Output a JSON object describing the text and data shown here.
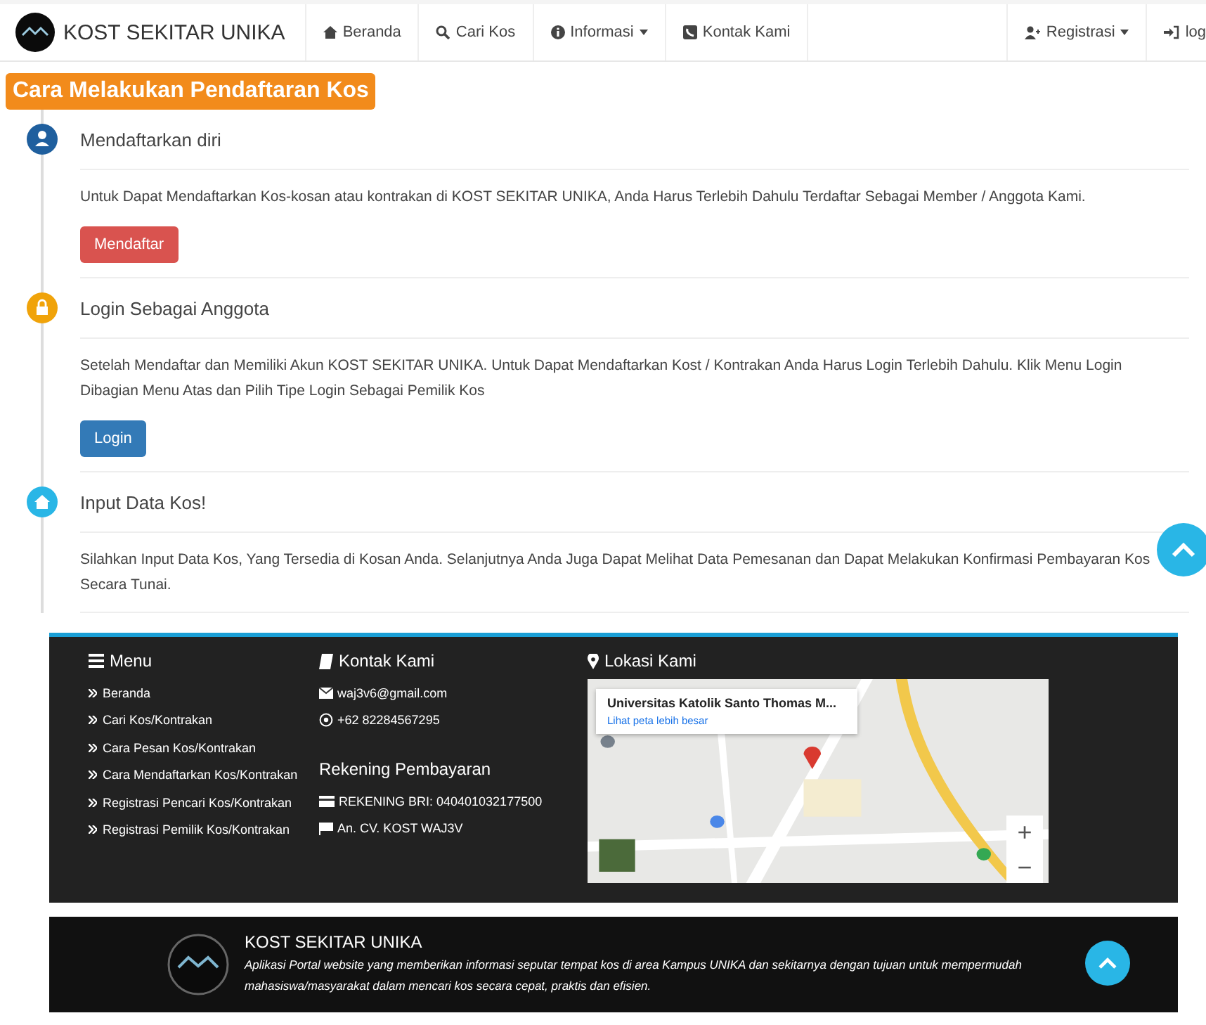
{
  "navbar": {
    "brand": "KOST SEKITAR UNIKA",
    "items": [
      {
        "label": "Beranda",
        "dropdown": false
      },
      {
        "label": "Cari Kos",
        "dropdown": false
      },
      {
        "label": "Informasi",
        "dropdown": true
      },
      {
        "label": "Kontak Kami",
        "dropdown": false
      }
    ],
    "right_items": [
      {
        "label": "Registrasi",
        "dropdown": true
      },
      {
        "label": "log",
        "dropdown": false
      }
    ]
  },
  "page_title": "Cara Melakukan Pendaftaran Kos",
  "steps": [
    {
      "title": "Mendaftarkan diri",
      "color": "#1f5f9e",
      "text": "Untuk Dapat Mendaftarkan Kos-kosan atau kontrakan di KOST SEKITAR UNIKA, Anda Harus Terlebih Dahulu Terdaftar Sebagai Member / Anggota Kami.",
      "button": {
        "label": "Mendaftar",
        "kind": "danger"
      }
    },
    {
      "title": "Login Sebagai Anggota",
      "color": "#f0a30a",
      "text": "Setelah Mendaftar dan Memiliki Akun KOST SEKITAR UNIKA. Untuk Dapat Mendaftarkan Kost / Kontrakan Anda Harus Login Terlebih Dahulu. Klik Menu Login Dibagian Menu Atas dan Pilih Tipe Login Sebagai Pemilik Kos",
      "button": {
        "label": "Login",
        "kind": "primary"
      }
    },
    {
      "title": "Input Data Kos!",
      "color": "#29b6e6",
      "text": "Silahkan Input Data Kos, Yang Tersedia di Kosan Anda. Selanjutnya Anda Juga Dapat Melihat Data Pemesanan dan Dapat Melakukan Konfirmasi Pembayaran Kos Secara Tunai."
    }
  ],
  "footer": {
    "menu": {
      "heading": "Menu",
      "links": [
        "Beranda",
        "Cari Kos/Kontrakan",
        "Cara Pesan Kos/Kontrakan",
        "Cara Mendaftarkan Kos/Kontrakan",
        "Registrasi Pencari Kos/Kontrakan",
        "Registrasi Pemilik Kos/Kontrakan"
      ]
    },
    "contact": {
      "heading": "Kontak Kami",
      "items": [
        "waj3v6@gmail.com",
        "+62 82284567295"
      ]
    },
    "payment": {
      "heading": "Rekening Pembayaran",
      "items": [
        "REKENING BRI: 040401032177500",
        "An. CV. KOST WAJ3V"
      ]
    },
    "location": {
      "heading": "Lokasi Kami",
      "map": {
        "place": "Universitas Katolik Santo Thomas M...",
        "link": "Lihat peta lebih besar",
        "zoom_in": "+",
        "zoom_out": "−"
      }
    }
  },
  "bottom": {
    "title": "KOST SEKITAR UNIKA",
    "description": "Aplikasi Portal website yang memberikan informasi seputar tempat kos di area Kampus UNIKA dan sekitarnya dengan tujuan untuk mempermudah mahasiswa/masyarakat dalam mencari kos secara cepat, praktis dan efisien."
  }
}
